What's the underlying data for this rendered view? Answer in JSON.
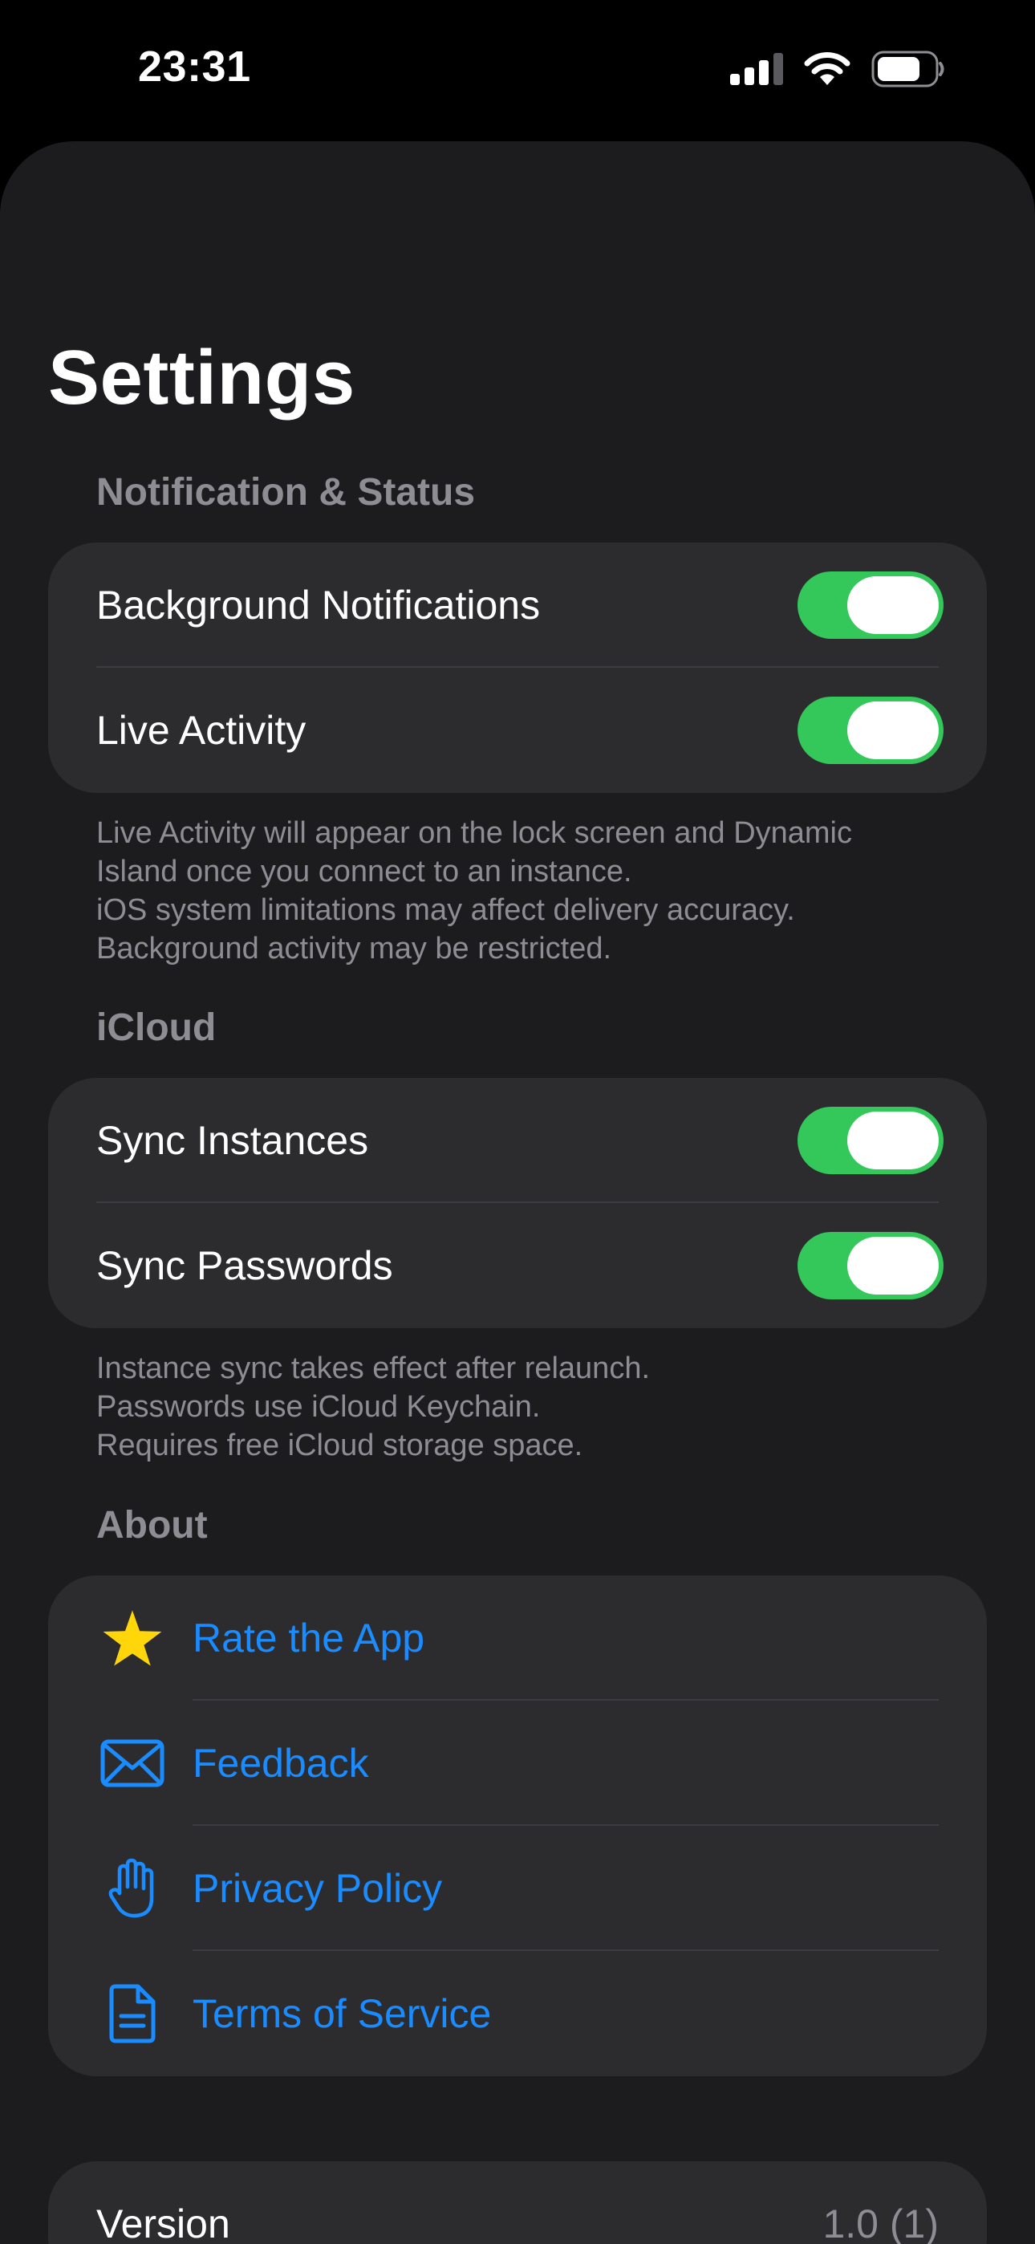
{
  "status_bar": {
    "time": "23:31",
    "icons": [
      "cellular-signal-icon",
      "wifi-icon",
      "battery-icon"
    ]
  },
  "title": "Settings",
  "sections": {
    "notifications": {
      "header": "Notification & Status",
      "rows": [
        {
          "label": "Background Notifications",
          "enabled": true
        },
        {
          "label": "Live Activity",
          "enabled": true
        }
      ],
      "footer": [
        "Live Activity will appear on the lock screen and Dynamic",
        "Island once you connect to an instance.",
        "iOS system limitations may affect delivery accuracy.",
        "Background activity may be restricted."
      ]
    },
    "icloud": {
      "header": "iCloud",
      "rows": [
        {
          "label": "Sync Instances",
          "enabled": true
        },
        {
          "label": "Sync Passwords",
          "enabled": true
        }
      ],
      "footer": [
        "Instance sync takes effect after relaunch.",
        "Passwords use iCloud Keychain.",
        "Requires free iCloud storage space."
      ]
    },
    "about": {
      "header": "About",
      "links": [
        {
          "label": "Rate the App",
          "icon": "star-icon"
        },
        {
          "label": "Feedback",
          "icon": "envelope-icon"
        },
        {
          "label": "Privacy Policy",
          "icon": "hand-raised-icon"
        },
        {
          "label": "Terms of Service",
          "icon": "document-icon"
        }
      ]
    },
    "version": {
      "label": "Version",
      "value": "1.0 (1)"
    }
  },
  "colors": {
    "background": "#000000",
    "sheet": "#1c1c1e",
    "group": "#2c2c2e",
    "toggle_on": "#34c759",
    "link": "#1a8cff",
    "star": "#ffd60a",
    "secondary_text": "#8d8d93"
  }
}
